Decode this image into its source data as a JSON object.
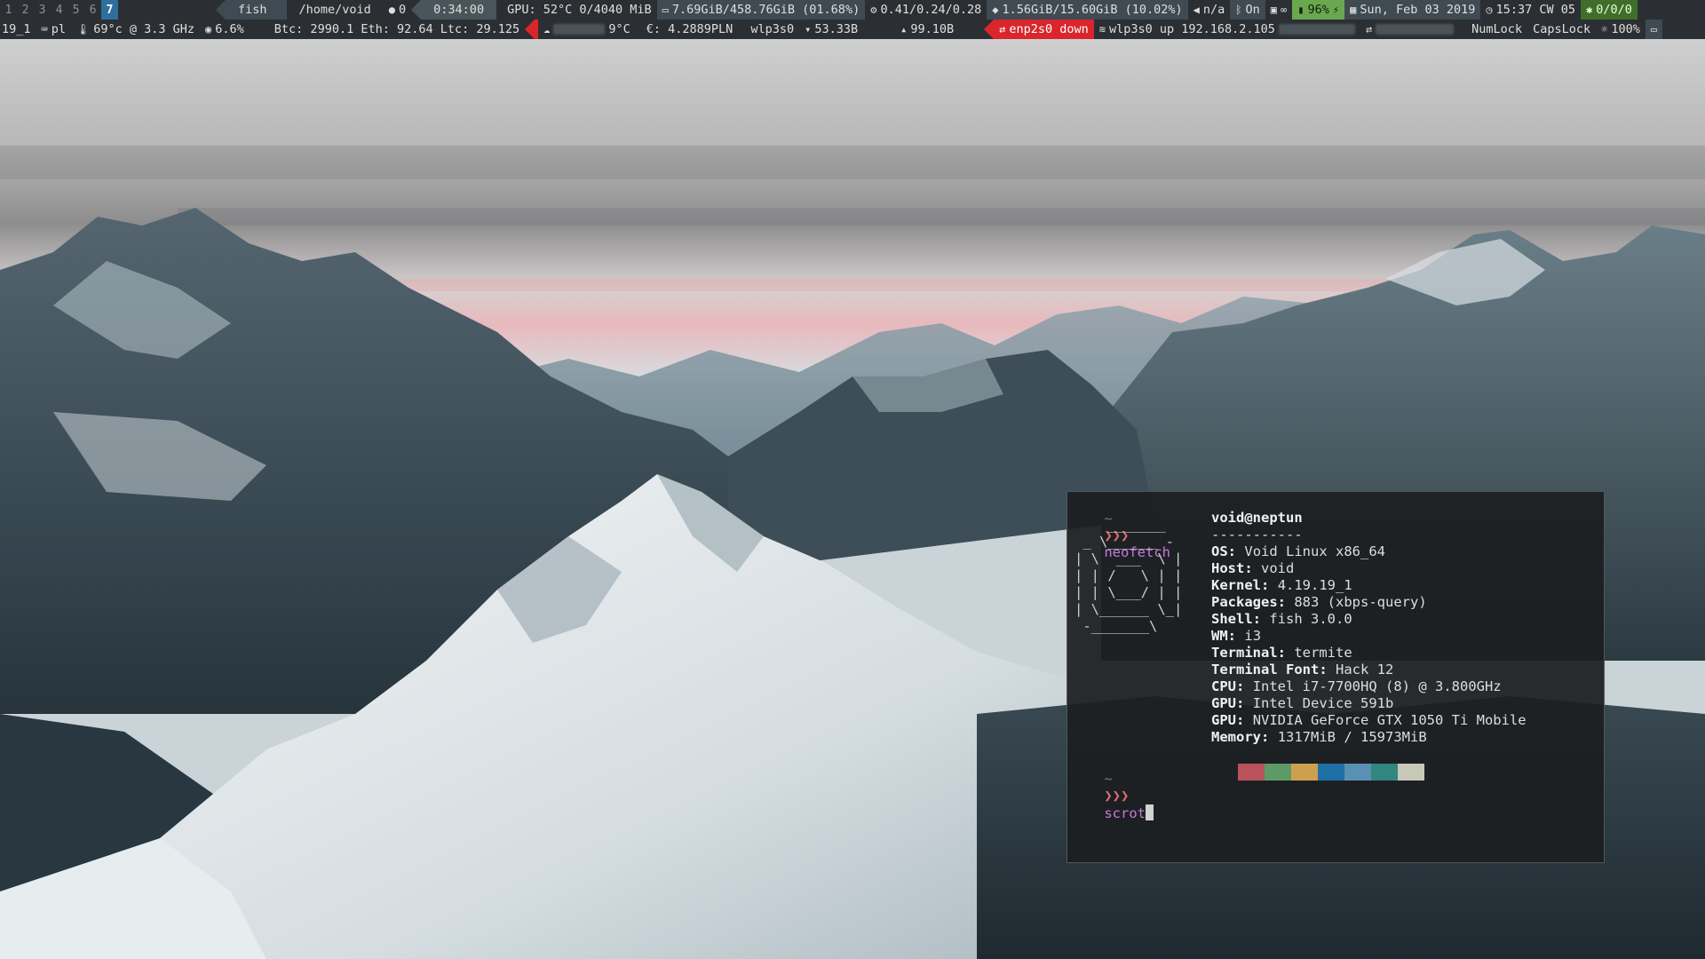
{
  "top_bar": {
    "workspaces": [
      "1",
      "2",
      "3",
      "4",
      "5",
      "6",
      "7"
    ],
    "active_workspace": "7",
    "window_title": "fish",
    "path": "/home/void",
    "git_count": "0",
    "timer": "0:34:00",
    "gpu": "GPU: 52°C 0/4040 MiB",
    "disk": "7.69GiB/458.76GiB (01.68%)",
    "load": "0.41/0.24/0.28",
    "memory": "1.56GiB/15.60GiB (10.02%)",
    "volume": "n/a",
    "bluetooth": "On",
    "battery": "96%",
    "date": "Sun, Feb 03 2019",
    "time": "15:37 CW 05",
    "updates": "0/0/0"
  },
  "bottom_bar": {
    "kernel_short": "19_1",
    "keyboard_layout": "pl",
    "cpu_temp": "69°c @ 3.3 GHz",
    "cpu_usage": "6.6%",
    "crypto": "Btc: 2990.1 Eth: 92.64 Ltc: 29.125",
    "weather_temp": "9°C",
    "currency": "€: 4.2889PLN",
    "net_iface": "wlp3s0",
    "net_down": "53.33B",
    "net_up": "99.10B",
    "eth_status": "enp2s0 down",
    "wifi_status": "wlp3s0 up 192.168.2.105",
    "numlock": "NumLock",
    "capslock": "CapsLock",
    "brightness": "100%"
  },
  "terminal": {
    "prompt_tilde": "~",
    "prompt_arrows": "❯❯❯",
    "command1": "neofetch",
    "command2": "scrot",
    "ascii_art": "    _______\n _ \\______ -\n| \\  ___  \\ |\n| | /   \\ | |\n| | \\___/ | |\n| \\______ \\_|\n -_______\\",
    "userhost": "void@neptun",
    "separator": "-----------",
    "info": [
      {
        "key": "OS",
        "value": "Void Linux x86_64"
      },
      {
        "key": "Host",
        "value": "void"
      },
      {
        "key": "Kernel",
        "value": "4.19.19_1"
      },
      {
        "key": "Packages",
        "value": "883 (xbps-query)"
      },
      {
        "key": "Shell",
        "value": "fish 3.0.0"
      },
      {
        "key": "WM",
        "value": "i3"
      },
      {
        "key": "Terminal",
        "value": "termite"
      },
      {
        "key": "Terminal Font",
        "value": "Hack 12"
      },
      {
        "key": "CPU",
        "value": "Intel i7-7700HQ (8) @ 3.800GHz"
      },
      {
        "key": "GPU",
        "value": "Intel Device 591b"
      },
      {
        "key": "GPU",
        "value": "NVIDIA GeForce GTX 1050 Ti Mobile"
      },
      {
        "key": "Memory",
        "value": "1317MiB / 15973MiB"
      }
    ],
    "palette": [
      "#b9525a",
      "#5e9a66",
      "#cda04f",
      "#1e6fa6",
      "#5a90b4",
      "#318680",
      "#c7c8b8"
    ]
  },
  "colors": {
    "bar_bg": "#2b2f33",
    "active_ws": "#2f6f9e",
    "alert_red": "#d8262c",
    "battery_green": "#6aa84f",
    "terminal_bg": "#1c1e20"
  }
}
